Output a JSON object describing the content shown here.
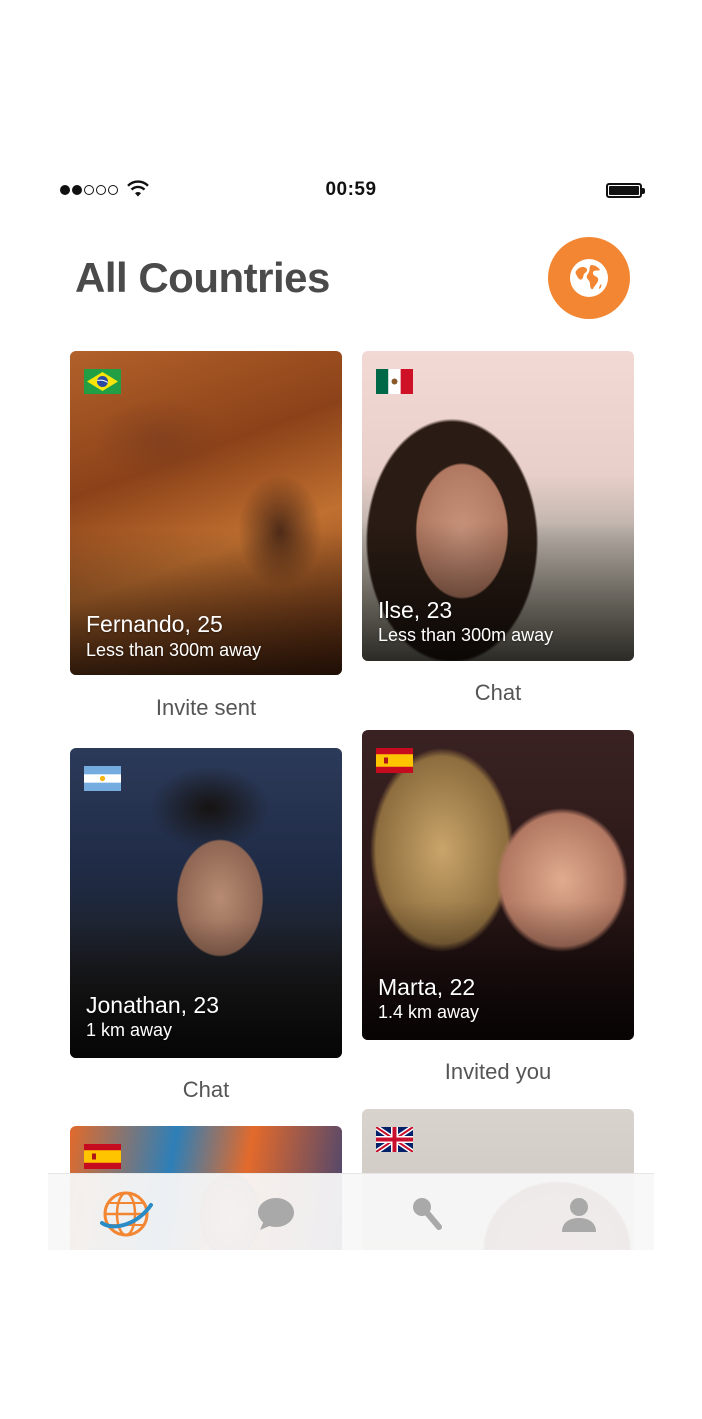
{
  "status_bar": {
    "time": "00:59"
  },
  "header": {
    "title": "All Countries",
    "globe_button_icon": "globe-icon"
  },
  "colors": {
    "accent": "#f28633",
    "text": "#4a4a4a"
  },
  "cards": [
    {
      "name_age": "Fernando, 25",
      "distance": "Less than 300m away",
      "flag": "brazil",
      "status": "Invite sent"
    },
    {
      "name_age": "Ilse, 23",
      "distance": "Less than 300m away",
      "flag": "mexico",
      "status": "Chat"
    },
    {
      "name_age": "Jonathan, 23",
      "distance": "1 km away",
      "flag": "argentina",
      "status": "Chat"
    },
    {
      "name_age": "Marta, 22",
      "distance": "1.4 km away",
      "flag": "spain",
      "status": "Invited you"
    },
    {
      "flag": "spain"
    },
    {
      "flag": "united-kingdom"
    }
  ],
  "tabbar": {
    "tabs": [
      "globe-icon",
      "chat-bubble-icon",
      "search-icon",
      "profile-icon"
    ],
    "active": 0
  }
}
